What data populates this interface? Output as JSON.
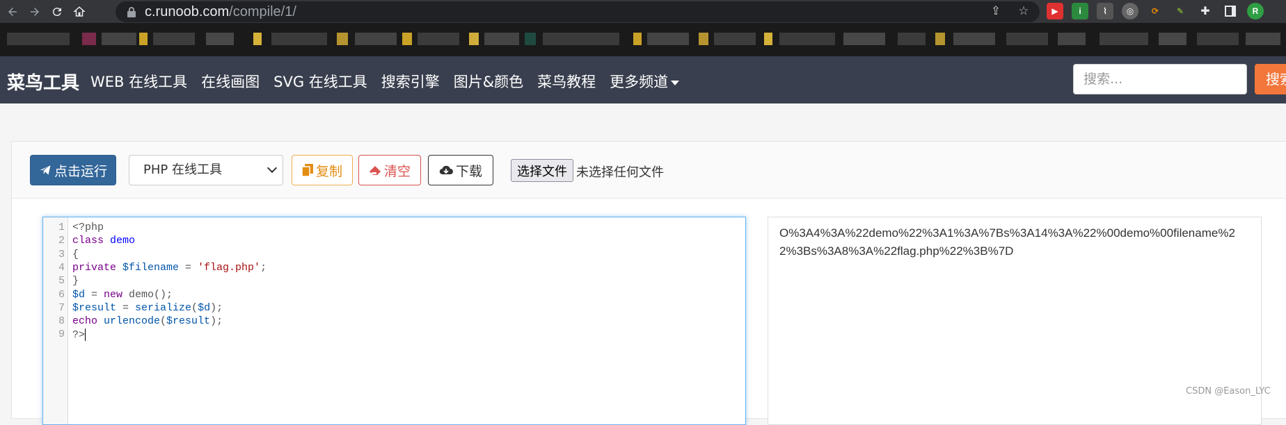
{
  "browser": {
    "url_host": "c.runoob.com",
    "url_path": "/compile/1/"
  },
  "header": {
    "brand": "菜鸟工具",
    "nav": [
      "WEB 在线工具",
      "在线画图",
      "SVG 在线工具",
      "搜索引擎",
      "图片&颜色",
      "菜鸟教程",
      "更多频道"
    ],
    "search_placeholder": "搜索...",
    "search_button": "搜索"
  },
  "toolbar": {
    "run_label": "点击运行",
    "language_selected": "PHP 在线工具",
    "copy_label": "复制",
    "clear_label": "清空",
    "download_label": "下载",
    "file_button": "选择文件",
    "file_status": "未选择任何文件"
  },
  "editor": {
    "line_numbers": [
      "1",
      "2",
      "3",
      "4",
      "5",
      "6",
      "7",
      "8",
      "9"
    ],
    "lines": [
      [
        {
          "t": "<?php",
          "c": ""
        }
      ],
      [
        {
          "t": "class ",
          "c": "kw"
        },
        {
          "t": "demo",
          "c": "def"
        }
      ],
      [
        {
          "t": "{",
          "c": ""
        }
      ],
      [
        {
          "t": "private ",
          "c": "kw"
        },
        {
          "t": "$filename",
          "c": "var"
        },
        {
          "t": " = ",
          "c": ""
        },
        {
          "t": "'flag.php'",
          "c": "str"
        },
        {
          "t": ";",
          "c": ""
        }
      ],
      [
        {
          "t": "}",
          "c": ""
        }
      ],
      [
        {
          "t": "$d",
          "c": "var"
        },
        {
          "t": " = ",
          "c": ""
        },
        {
          "t": "new ",
          "c": "kw"
        },
        {
          "t": "demo();",
          "c": ""
        }
      ],
      [
        {
          "t": "$result",
          "c": "var"
        },
        {
          "t": " = ",
          "c": ""
        },
        {
          "t": "serialize",
          "c": "var"
        },
        {
          "t": "(",
          "c": ""
        },
        {
          "t": "$d",
          "c": "var"
        },
        {
          "t": ");",
          "c": ""
        }
      ],
      [
        {
          "t": "echo ",
          "c": "kw"
        },
        {
          "t": "urlencode",
          "c": "var"
        },
        {
          "t": "(",
          "c": ""
        },
        {
          "t": "$result",
          "c": "var"
        },
        {
          "t": ");",
          "c": ""
        }
      ],
      [
        {
          "t": "?>",
          "c": ""
        }
      ]
    ]
  },
  "output": {
    "text": "O%3A4%3A%22demo%22%3A1%3A%7Bs%3A14%3A%22%00demo%00filename%22%3Bs%3A8%3A%22flag.php%22%3B%7D"
  },
  "watermark": "CSDN @Eason_LYC",
  "colors": {
    "header_bg": "#393f4e",
    "run_button": "#336699",
    "search_button": "#f3763a",
    "copy": "#e38d13",
    "clear": "#d9534f"
  }
}
